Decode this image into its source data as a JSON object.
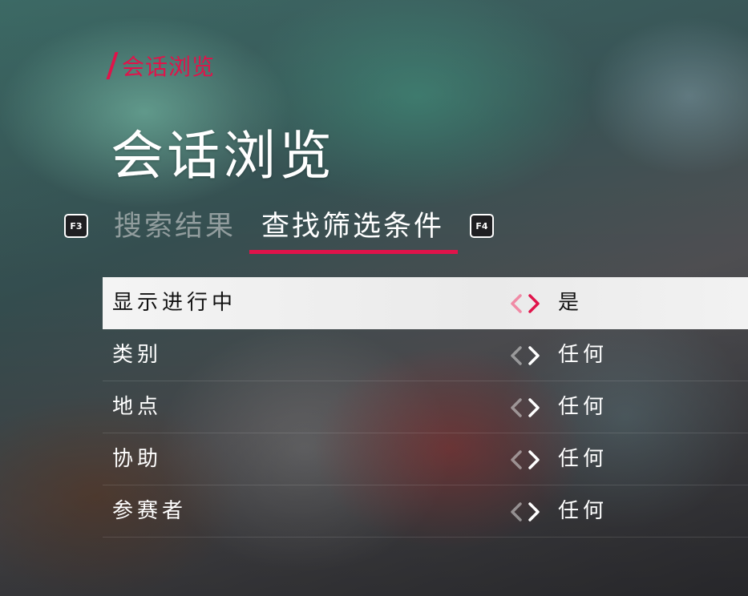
{
  "breadcrumb": {
    "label": "会话浏览"
  },
  "header": {
    "title": "会话浏览"
  },
  "tabs": {
    "prev_key": "F3",
    "next_key": "F4",
    "items": [
      {
        "label": "搜索结果",
        "active": false
      },
      {
        "label": "查找筛选条件",
        "active": true
      }
    ]
  },
  "filters": [
    {
      "label": "显示进行中",
      "value": "是",
      "selected": true
    },
    {
      "label": "类别",
      "value": "任何",
      "selected": false
    },
    {
      "label": "地点",
      "value": "任何",
      "selected": false
    },
    {
      "label": "协助",
      "value": "任何",
      "selected": false
    },
    {
      "label": "参赛者",
      "value": "任何",
      "selected": false
    }
  ],
  "colors": {
    "accent": "#e0134a",
    "selected_row_bg": "#f2f2f2",
    "text_primary": "#ffffff",
    "text_inactive": "#c8c8c8"
  },
  "icons": {
    "arrow_left": "chevron-left-icon",
    "arrow_right": "chevron-right-icon"
  }
}
